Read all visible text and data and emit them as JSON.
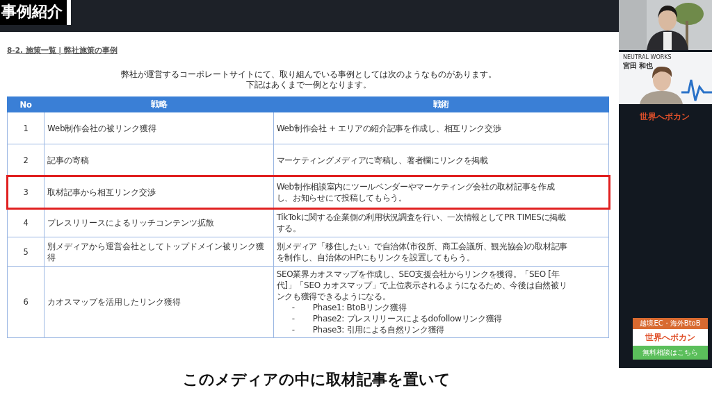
{
  "header": {
    "title": "事例紹介"
  },
  "slide": {
    "breadcrumb": "8-2. 施策一覧 | 弊社施策の事例",
    "intro": [
      "弊社が運営するコーポレートサイトにて、取り組んでいる事例としては次のようなものがあります。",
      "下記はあくまで一例となります。"
    ],
    "table": {
      "columns": [
        "No",
        "戦略",
        "戦術"
      ],
      "rows": [
        {
          "no": "1",
          "strategy": "Web制作会社の被リンク獲得",
          "tactic": [
            "Web制作会社 + エリアの紹介記事を作成し、相互リンク交渉"
          ],
          "bullets": [],
          "highlighted": false
        },
        {
          "no": "2",
          "strategy": "記事の寄稿",
          "tactic": [
            "マーケティングメディアに寄稿し、著者欄にリンクを掲載"
          ],
          "bullets": [],
          "highlighted": false
        },
        {
          "no": "3",
          "strategy": "取材記事から相互リンク交渉",
          "tactic": [
            "Web制作相談室内にツールベンダーやマーケティング会社の取材記事を作成",
            "し、お知らせにて投稿してもらう。"
          ],
          "bullets": [],
          "highlighted": true
        },
        {
          "no": "4",
          "strategy": "プレスリリースによるリッチコンテンツ拡散",
          "tactic": [
            "TikTokに関する企業側の利用状況調査を行い、一次情報としてPR TIMESに掲載",
            "する。"
          ],
          "bullets": [],
          "highlighted": false
        },
        {
          "no": "5",
          "strategy": "別メディアから運営会社としてトップドメイン被リンク獲得",
          "tactic": [
            "別メディア「移住したい」で自治体(市役所、商工会議所、観光協会)の取材記事",
            "を制作し、自治体のHPにもリンクを設置してもらう。"
          ],
          "bullets": [],
          "highlighted": false
        },
        {
          "no": "6",
          "strategy": "カオスマップを活用したリンク獲得",
          "tactic": [
            "SEO業界カオスマップを作成し、SEO支援会社からリンクを獲得。「SEO [年",
            "代]」「SEO カオスマップ」で上位表示されるようになるため、今後は自然被リ",
            "ンクも獲得できるようになる。"
          ],
          "bullets": [
            {
              "dash": "-",
              "text": "Phase1: BtoBリンク獲得"
            },
            {
              "dash": "-",
              "text": "Phase2: プレスリリースによるdofollowリンク獲得"
            },
            {
              "dash": "-",
              "text": "Phase3: 引用による自然リンク獲得"
            }
          ],
          "highlighted": false
        }
      ]
    }
  },
  "sidebar": {
    "company": "NEUTRAL WORKS",
    "person": "宮田 和也",
    "logo": "世界へボカン",
    "banner": {
      "top": "越境EC・海外BtoB",
      "logo": "世界へボカン",
      "button": "無料相談はこちら"
    }
  },
  "caption": "このメディアの中に取材記事を置いて"
}
